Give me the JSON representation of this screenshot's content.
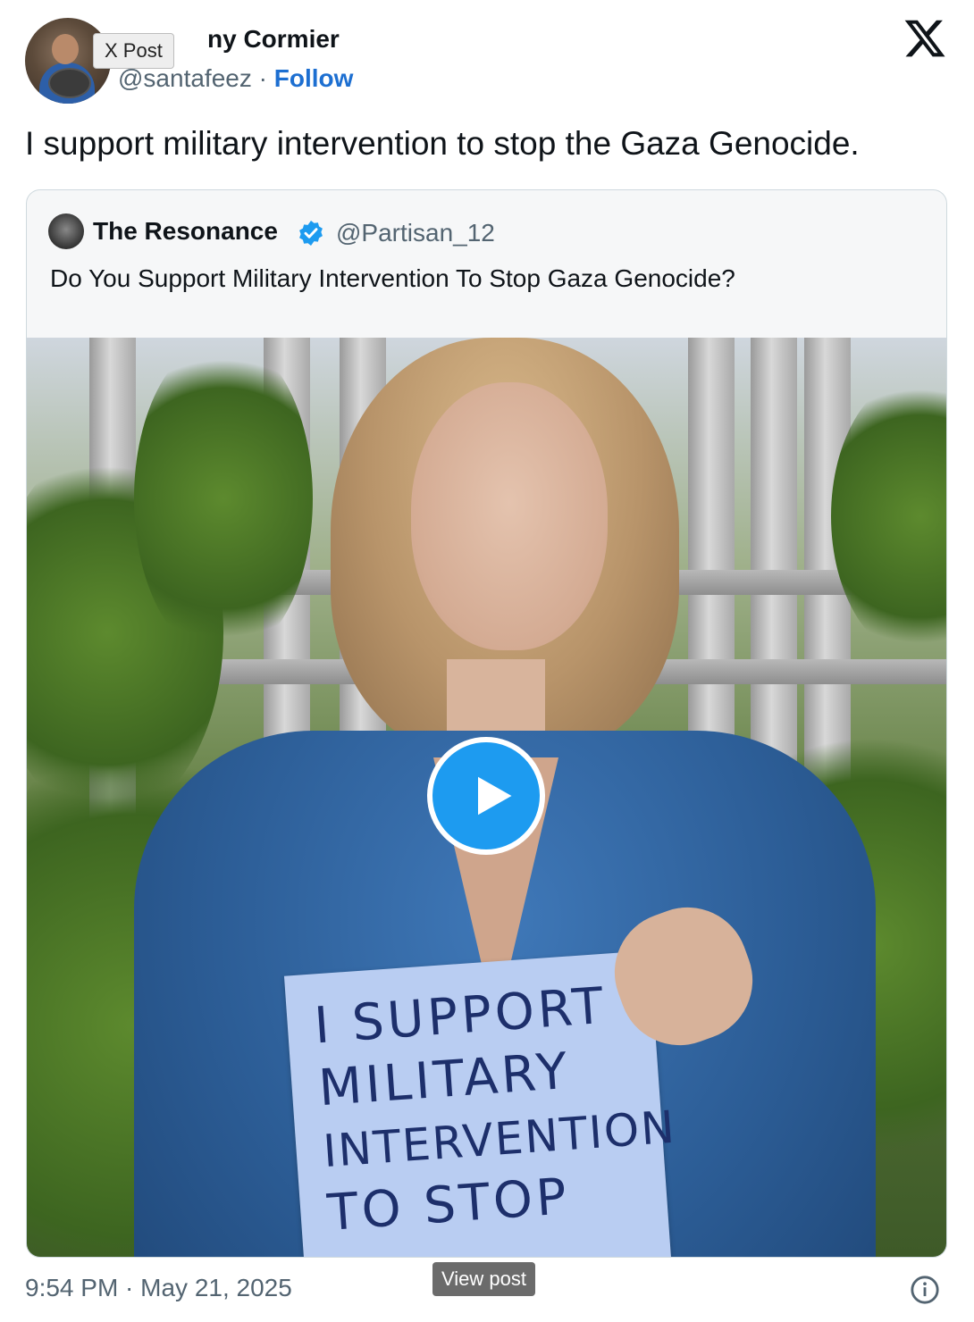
{
  "header": {
    "tooltip": "X Post",
    "author_name_visible": "ny Cormier",
    "handle": "@santafeez",
    "separator": "·",
    "follow_label": "Follow"
  },
  "tweet": {
    "text": "I support military intervention to stop the Gaza Genocide."
  },
  "quoted": {
    "name": "The Resonance",
    "handle": "@Partisan_12",
    "text": "Do You Support Military Intervention To Stop Gaza Genocide?",
    "sign_lines": [
      "I SUPPORT",
      "MILITARY",
      "INTERVENTION",
      "TO STOP"
    ]
  },
  "footer": {
    "timestamp": "9:54 PM · May 21, 2025",
    "view_post_label": "View post"
  },
  "icons": {
    "logo": "x-logo-icon",
    "verified": "verified-badge-icon",
    "play": "play-icon",
    "info": "info-icon"
  },
  "colors": {
    "link_blue": "#1d6fd1",
    "verified_blue": "#1d9bf0",
    "secondary_text": "#536471"
  }
}
